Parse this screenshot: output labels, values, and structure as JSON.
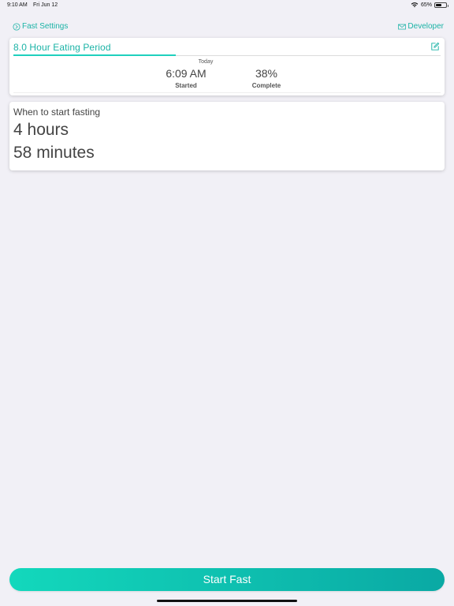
{
  "status_bar": {
    "time": "9:10 AM",
    "date": "Fri Jun 12",
    "battery": "65%",
    "battery_level": 0.65
  },
  "nav": {
    "left_label": "Fast Settings",
    "right_label": "Developer"
  },
  "period_card": {
    "title": "8.0 Hour Eating Period",
    "progress_fraction": 0.38,
    "today_label": "Today",
    "started_value": "6:09 AM",
    "started_label": "Started",
    "complete_value": "38%",
    "complete_label": "Complete"
  },
  "when_card": {
    "label": "When to start fasting",
    "hours": "4 hours",
    "minutes": "58 minutes"
  },
  "action": {
    "start_label": "Start Fast"
  },
  "colors": {
    "accent": "#1bb3a6",
    "gradient_start": "#13d8bc",
    "gradient_end": "#0aa9a4",
    "background": "#f1f0f6"
  },
  "icons": {
    "fast_settings": "clock-arrow-icon",
    "developer": "envelope-icon",
    "edit": "edit-icon",
    "wifi": "wifi-icon",
    "battery": "battery-icon"
  }
}
